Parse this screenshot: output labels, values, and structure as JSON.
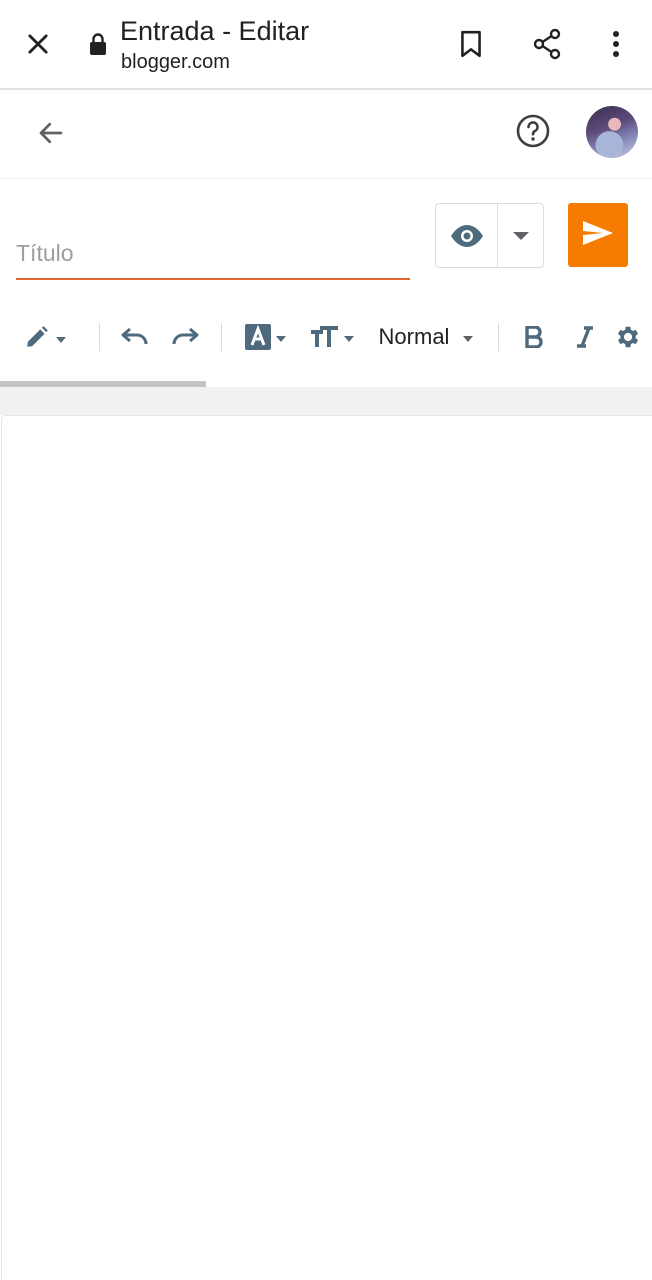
{
  "browser": {
    "page_title": "Entrada - Editar",
    "url": "blogger.com",
    "icons": {
      "close": "close-icon",
      "lock": "lock-icon",
      "bookmark": "bookmark-icon",
      "share": "share-icon",
      "more": "more-vert-icon"
    }
  },
  "header": {
    "icons": {
      "back": "arrow-back-icon",
      "help": "help-icon",
      "avatar": "user-avatar"
    }
  },
  "post": {
    "title_placeholder": "Título",
    "title_value": "",
    "preview_icon": "eye-icon",
    "preview_menu_icon": "caret-down-icon",
    "publish_icon": "send-icon"
  },
  "toolbar": {
    "paragraph_style": "Normal",
    "items": [
      "pencil-icon",
      "undo-icon",
      "redo-icon",
      "text-color-icon",
      "font-size-icon",
      "bold-icon",
      "italic-icon",
      "settings-icon"
    ]
  },
  "colors": {
    "accent": "#f57c00",
    "title_underline": "#e06533",
    "icon_gray": "#5f6368",
    "toolbar_icon": "#4e6a7c"
  }
}
